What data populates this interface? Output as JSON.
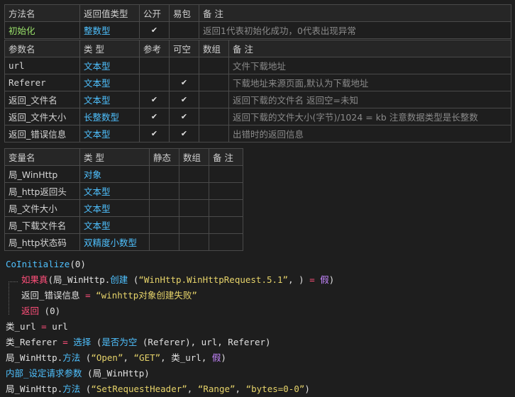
{
  "method_table": {
    "headers": [
      "方法名",
      "返回值类型",
      "公开",
      "易包",
      "备 注"
    ],
    "row": {
      "name": "初始化",
      "type": "整数型",
      "public": "✔",
      "easy": "",
      "note": "返回1代表初始化成功，0代表出现异常"
    }
  },
  "param_table": {
    "headers": [
      "参数名",
      "类 型",
      "参考",
      "可空",
      "数组",
      "备 注"
    ],
    "rows": [
      {
        "name": "url",
        "type": "文本型",
        "ref": "",
        "nullable": "",
        "array": "",
        "note": "文件下载地址"
      },
      {
        "name": "Referer",
        "type": "文本型",
        "ref": "",
        "nullable": "✔",
        "array": "",
        "note": "下载地址来源页面,默认为下载地址"
      },
      {
        "name": "返回_文件名",
        "type": "文本型",
        "ref": "✔",
        "nullable": "✔",
        "array": "",
        "note": "返回下载的文件名 返回空=未知"
      },
      {
        "name": "返回_文件大小",
        "type": "长整数型",
        "ref": "✔",
        "nullable": "✔",
        "array": "",
        "note": "返回下载的文件大小(字节)/1024 = kb 注意数据类型是长整数"
      },
      {
        "name": "返回_错误信息",
        "type": "文本型",
        "ref": "✔",
        "nullable": "✔",
        "array": "",
        "note": "出错时的返回信息"
      }
    ]
  },
  "var_table": {
    "headers": [
      "变量名",
      "类 型",
      "静态",
      "数组",
      "备 注"
    ],
    "rows": [
      {
        "name": "局_WinHttp",
        "type": "对象"
      },
      {
        "name": "局_http返回头",
        "type": "文本型"
      },
      {
        "name": "局_文件大小",
        "type": "文本型"
      },
      {
        "name": "局_下载文件名",
        "type": "文本型"
      },
      {
        "name": "局_http状态码",
        "type": "双精度小数型"
      }
    ]
  },
  "code": {
    "l1_fn": "CoInitialize",
    "l1_arg": "(0)",
    "l2_kw": "如果真",
    "l2_a": "(局_WinHttp.",
    "l2_fn": "创建",
    "l2_b": " (",
    "l2_str": "“WinHttp.WinHttpRequest.5.1”",
    "l2_c": ", ) ",
    "l2_op": "=",
    "l2_d": " ",
    "l2_false": "假",
    "l2_e": ")",
    "l3_a": "返回_错误信息 ",
    "l3_op": "=",
    "l3_str": "“winhttp对象创建失败”",
    "l4_kw": "返回",
    "l4_arg": " (0)",
    "l5_a": "类_url ",
    "l5_op": "=",
    "l5_b": " url",
    "l6_a": "类_Referer ",
    "l6_op": "=",
    "l6_fn": " 选择",
    "l6_b": " (",
    "l6_fn2": "是否为空",
    "l6_c": " (Referer), url, Referer)",
    "l7_a": "局_WinHttp.",
    "l7_fn": "方法",
    "l7_b": " (",
    "l7_s1": "“Open”",
    "l7_c": ", ",
    "l7_s2": "“GET”",
    "l7_d": ", 类_url, ",
    "l7_false": "假",
    "l7_e": ")",
    "l8_fn": "内部_设定请求参数",
    "l8_a": " (局_WinHttp)",
    "l9_a": "局_WinHttp.",
    "l9_fn": "方法",
    "l9_b": " (",
    "l9_s1": "“SetRequestHeader”",
    "l9_c": ", ",
    "l9_s2": "“Range”",
    "l9_d": ", ",
    "l9_s3": "“bytes=0-0”",
    "l9_e": ")"
  }
}
